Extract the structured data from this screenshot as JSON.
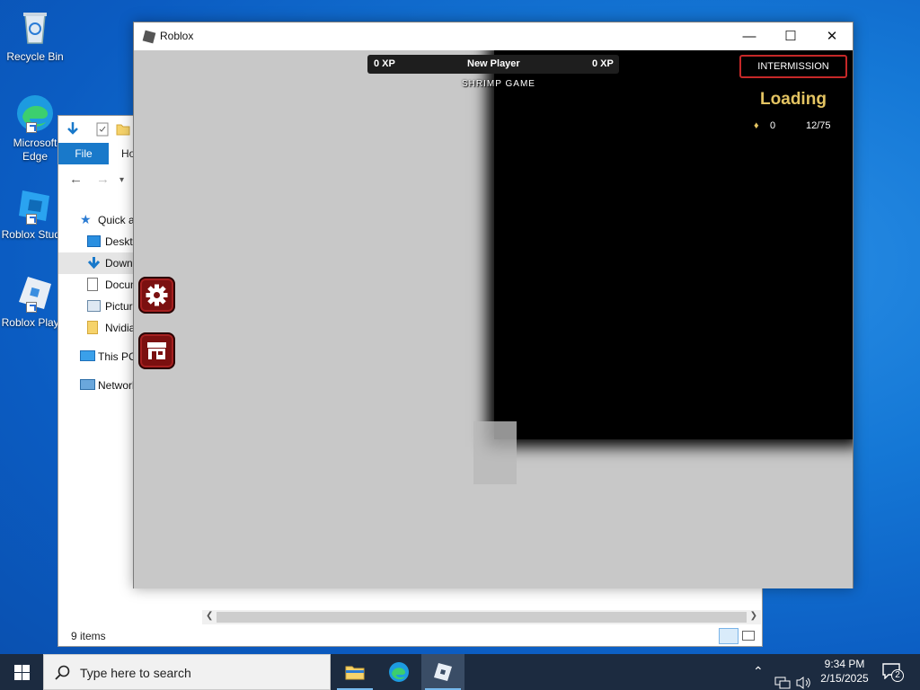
{
  "desktop": {
    "icons": [
      {
        "label": "Recycle Bin"
      },
      {
        "label": "Microsoft Edge"
      },
      {
        "label": "Roblox Studio"
      },
      {
        "label": "Roblox Player"
      }
    ]
  },
  "explorer": {
    "ribbon": {
      "file_label": "File",
      "home_label": "Ho"
    },
    "tree": [
      {
        "label": "Quick access"
      },
      {
        "label": "Desktop"
      },
      {
        "label": "Downloads"
      },
      {
        "label": "Documents"
      },
      {
        "label": "Pictures"
      },
      {
        "label": "Nvidia"
      },
      {
        "label": "This PC"
      },
      {
        "label": "Network"
      }
    ],
    "status": "9 items"
  },
  "roblox": {
    "title": "Roblox",
    "controls": {
      "minimize": "—",
      "maximize": "☐",
      "close": "✕"
    },
    "hud": {
      "xp_left": "0 XP",
      "player_name": "New Player",
      "xp_right": "0 XP",
      "brand": "SHRIMP GAME",
      "status_box": "INTERMISSION",
      "status_text": "Loading",
      "coins": "0",
      "players": "12/75"
    }
  },
  "taskbar": {
    "search_placeholder": "Type here to search",
    "time": "9:34 PM",
    "date": "2/15/2025",
    "notification_count": "2"
  }
}
